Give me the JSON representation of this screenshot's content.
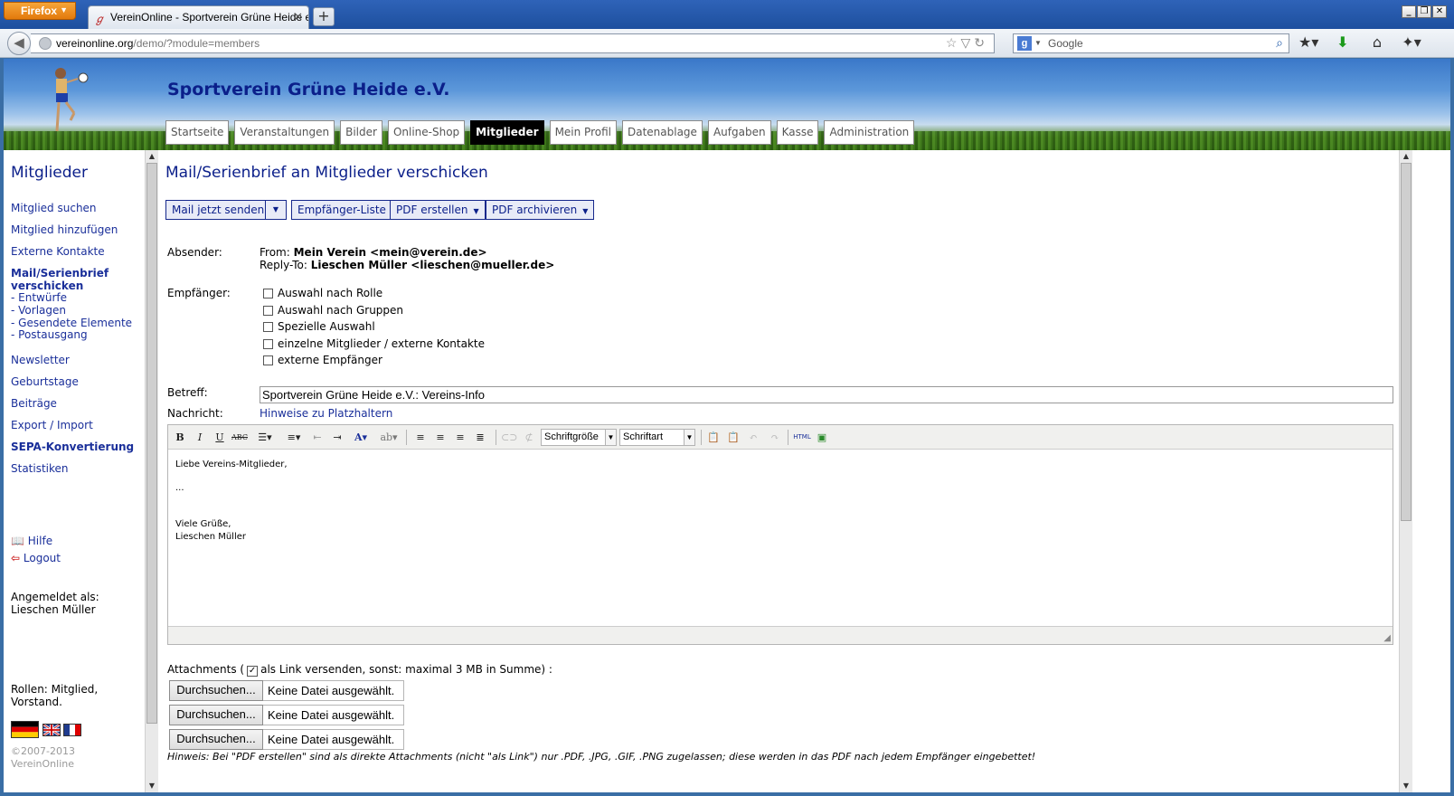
{
  "browser": {
    "menu_label": "Firefox",
    "tab_title": "VereinOnline - Sportverein Grüne Heide e.V.",
    "url_host": "vereinonline.org",
    "url_path": "/demo/?module=members",
    "search_placeholder": "Google"
  },
  "site": {
    "title": "Sportverein Grüne Heide e.V.",
    "nav": [
      {
        "label": "Startseite"
      },
      {
        "label": "Veranstaltungen"
      },
      {
        "label": "Bilder"
      },
      {
        "label": "Online-Shop"
      },
      {
        "label": "Mitglieder",
        "active": true
      },
      {
        "label": "Mein Profil"
      },
      {
        "label": "Datenablage"
      },
      {
        "label": "Aufgaben"
      },
      {
        "label": "Kasse"
      },
      {
        "label": "Administration"
      }
    ]
  },
  "sidebar": {
    "title": "Mitglieder",
    "links": [
      "Mitglied suchen",
      "Mitglied hinzufügen",
      "Externe Kontakte",
      "Mail/Serienbrief",
      "verschicken",
      "- Entwürfe",
      "- Vorlagen",
      "- Gesendete Elemente",
      "- Postausgang",
      "Newsletter",
      "Geburtstage",
      "Beiträge",
      "Export / Import",
      "SEPA-Konvertierung",
      "Statistiken"
    ],
    "help": "Hilfe",
    "logout": "Logout",
    "logged_in_label": "Angemeldet als:",
    "logged_in_user": "Lieschen Müller",
    "roles_line1": "Rollen: Mitglied,",
    "roles_line2": "Vorstand.",
    "copyright1": "©2007-2013",
    "copyright2": "VereinOnline"
  },
  "main": {
    "title": "Mail/Serienbrief an Mitglieder verschicken",
    "buttons": {
      "send": "Mail jetzt senden",
      "recipients": "Empfänger-Liste",
      "pdf_create": "PDF erstellen",
      "pdf_archive": "PDF archivieren"
    },
    "sender_label": "Absender:",
    "from_prefix": "From:",
    "from_value": "Mein Verein <mein@verein.de>",
    "replyto_prefix": "Reply-To:",
    "replyto_value": "Lieschen Müller <lieschen@mueller.de>",
    "recipients_label": "Empfänger:",
    "recipient_options": [
      "Auswahl nach Rolle",
      "Auswahl nach Gruppen",
      "Spezielle Auswahl",
      "einzelne Mitglieder / externe Kontakte",
      "externe Empfänger"
    ],
    "subject_label": "Betreff:",
    "subject_value": "Sportverein Grüne Heide e.V.: Vereins-Info",
    "message_label": "Nachricht:",
    "placeholder_hint": "Hinweise zu Platzhaltern",
    "editor": {
      "font_size_label": "Schriftgröße",
      "font_family_label": "Schriftart",
      "body_line1": "Liebe Vereins-Mitglieder,",
      "body_line2": "...",
      "body_line3": "Viele Grüße,",
      "body_line4": "Lieschen Müller"
    },
    "attachments_prefix": "Attachments (",
    "attachments_checked": "✓",
    "attachments_suffix": "als Link versenden, sonst: maximal 3 MB in Summe) :",
    "file_button": "Durchsuchen...",
    "file_none": "Keine Datei ausgewählt.",
    "footnote": "Hinweis: Bei \"PDF erstellen\" sind als direkte Attachments (nicht \"als Link\") nur .PDF, .JPG, .GIF, .PNG zugelassen; diese werden in das PDF nach jedem Empfänger eingebettet!"
  },
  "colors": {
    "link": "#1a2f9a",
    "title": "#0b1f8a",
    "firefox_orange": "#e37a0c"
  }
}
